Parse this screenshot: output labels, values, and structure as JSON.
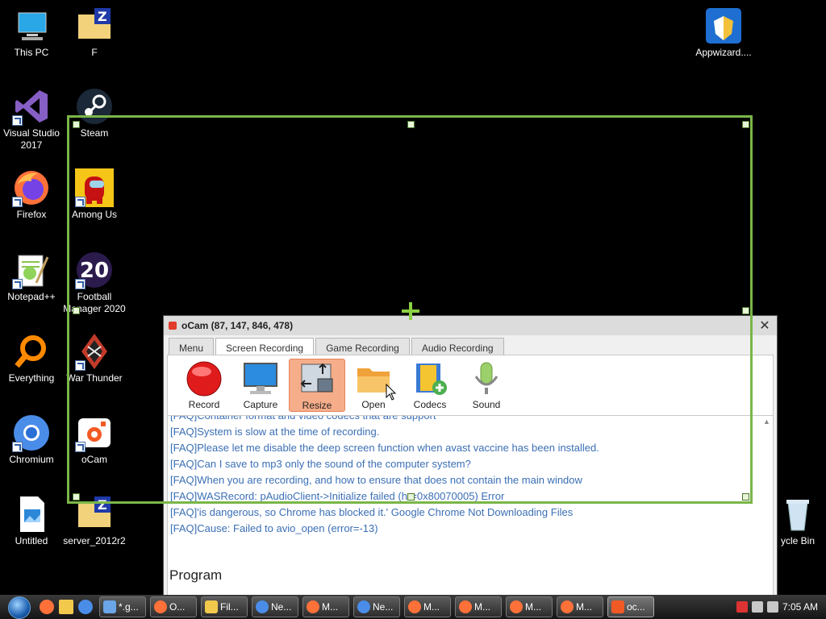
{
  "desktop": {
    "icons": [
      {
        "label": "This PC",
        "icon": "computer-icon"
      },
      {
        "label": "F",
        "icon": "winrar-folder-icon"
      },
      {
        "label": "Appwizard....",
        "icon": "appwizard-shield-icon"
      },
      {
        "label": "Visual Studio 2017",
        "icon": "visual-studio-icon"
      },
      {
        "label": "Steam",
        "icon": "steam-icon"
      },
      {
        "label": "Firefox",
        "icon": "firefox-icon"
      },
      {
        "label": "Among Us",
        "icon": "among-us-icon"
      },
      {
        "label": "Notepad++",
        "icon": "notepad-plus-icon"
      },
      {
        "label": "Football Manager 2020",
        "icon": "football-manager-icon"
      },
      {
        "label": "Everything",
        "icon": "everything-search-icon"
      },
      {
        "label": "War Thunder",
        "icon": "war-thunder-icon"
      },
      {
        "label": "Chromium",
        "icon": "chromium-icon"
      },
      {
        "label": "oCam",
        "icon": "ocam-icon"
      },
      {
        "label": "Untitled",
        "icon": "image-file-icon"
      },
      {
        "label": "server_2012r2",
        "icon": "winrar-folder-icon"
      },
      {
        "label": "ycle Bin",
        "icon": "recycle-bin-icon"
      }
    ],
    "fm_badge": "20"
  },
  "ocam": {
    "title": "oCam (87, 147, 846, 478)",
    "tabs": [
      "Menu",
      "Screen Recording",
      "Game Recording",
      "Audio Recording"
    ],
    "active_tab": "Screen Recording",
    "toolbar": [
      {
        "label": "Record",
        "icon": "record-icon"
      },
      {
        "label": "Capture",
        "icon": "monitor-capture-icon"
      },
      {
        "label": "Resize",
        "icon": "resize-icon",
        "active": true
      },
      {
        "label": "Open",
        "icon": "folder-open-icon"
      },
      {
        "label": "Codecs",
        "icon": "codecs-film-icon"
      },
      {
        "label": "Sound",
        "icon": "microphone-icon"
      }
    ],
    "faq": [
      "[FAQ]Container format and video codecs that are support",
      "[FAQ]System is slow at the time of recording.",
      "[FAQ]Please let me disable the deep screen function when avast vaccine has been installed.",
      "[FAQ]Can I save to mp3 only the sound of the computer system?",
      "[FAQ]When you are recording, and how to ensure that does not contain the main window",
      "[FAQ]WASRecord: pAudioClient->Initialize failed (hr=0x80070005) Error",
      "[FAQ]'is dangerous, so Chrome has blocked it.' Google Chrome Not Downloading Files",
      "[FAQ]Cause: Failed to avio_open (error=-13)"
    ],
    "section_heading": "Program"
  },
  "taskbar": {
    "tasks": [
      "*.g...",
      "O...",
      "Fil...",
      "Ne...",
      "M...",
      "Ne...",
      "M...",
      "M...",
      "M...",
      "M...",
      "oc..."
    ],
    "clock": "7:05 AM"
  },
  "colors": {
    "selection": "#7ab648",
    "faq_link": "#3b6fb6",
    "resize_active": "#f6ad8a"
  }
}
